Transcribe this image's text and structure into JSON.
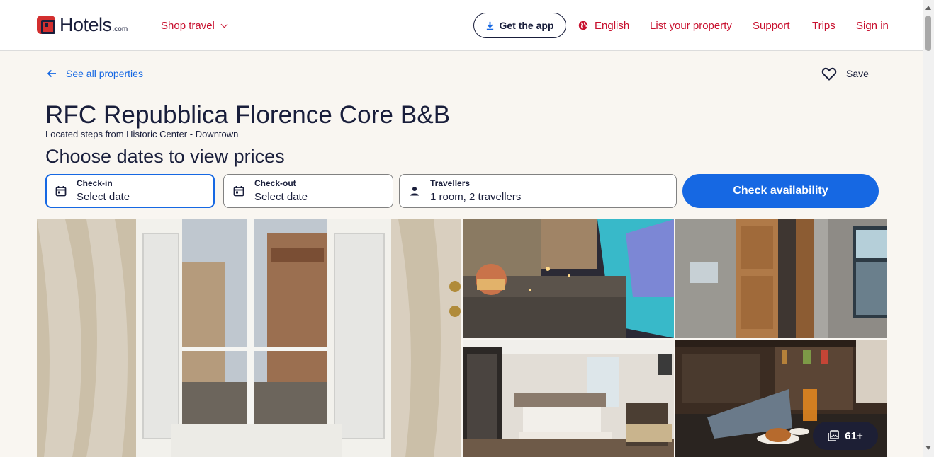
{
  "header": {
    "logo_text": "Hotels",
    "logo_suffix": ".com",
    "shop_travel": "Shop travel",
    "get_app": "Get the app",
    "language": "English",
    "list_property": "List your property",
    "support": "Support",
    "trips": "Trips",
    "sign_in": "Sign in"
  },
  "nav": {
    "back_label": "See all properties",
    "save_label": "Save"
  },
  "property": {
    "name": "RFC Repubblica Florence Core B&B",
    "location": "Located steps from Historic Center - Downtown"
  },
  "booking": {
    "heading": "Choose dates to view prices",
    "checkin_label": "Check-in",
    "checkin_value": "Select date",
    "checkout_label": "Check-out",
    "checkout_value": "Select date",
    "travellers_label": "Travellers",
    "travellers_value": "1 room, 2 travellers",
    "check_button": "Check availability"
  },
  "gallery": {
    "photo_count": "61+"
  },
  "colors": {
    "brand_red": "#c8102e",
    "primary_blue": "#1668e3",
    "text_dark": "#191e3b",
    "page_bg": "#f9f6f1"
  }
}
